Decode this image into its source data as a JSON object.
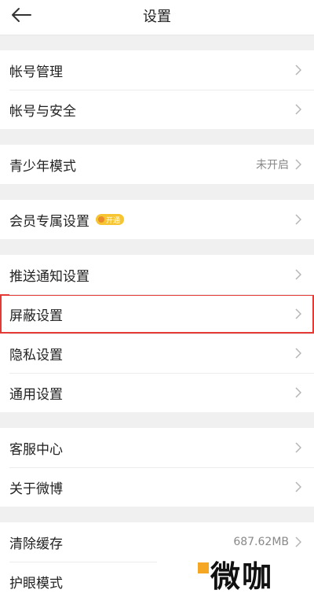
{
  "header": {
    "title": "设置"
  },
  "groups": [
    {
      "items": [
        {
          "label": "帐号管理"
        },
        {
          "label": "帐号与安全"
        }
      ]
    },
    {
      "items": [
        {
          "label": "青少年模式",
          "value": "未开启"
        }
      ]
    },
    {
      "items": [
        {
          "label": "会员专属设置",
          "badge": "开通"
        }
      ]
    },
    {
      "items": [
        {
          "label": "推送通知设置"
        },
        {
          "label": "屏蔽设置"
        },
        {
          "label": "隐私设置"
        },
        {
          "label": "通用设置"
        }
      ]
    },
    {
      "items": [
        {
          "label": "客服中心"
        },
        {
          "label": "关于微博"
        }
      ]
    },
    {
      "items": [
        {
          "label": "清除缓存",
          "value": "687.62MB"
        },
        {
          "label": "护眼模式"
        }
      ]
    }
  ],
  "watermark": {
    "text": "微咖"
  },
  "colors": {
    "highlight": "#e53935",
    "badge": "#f7c531",
    "background": "#f0f0f0"
  }
}
